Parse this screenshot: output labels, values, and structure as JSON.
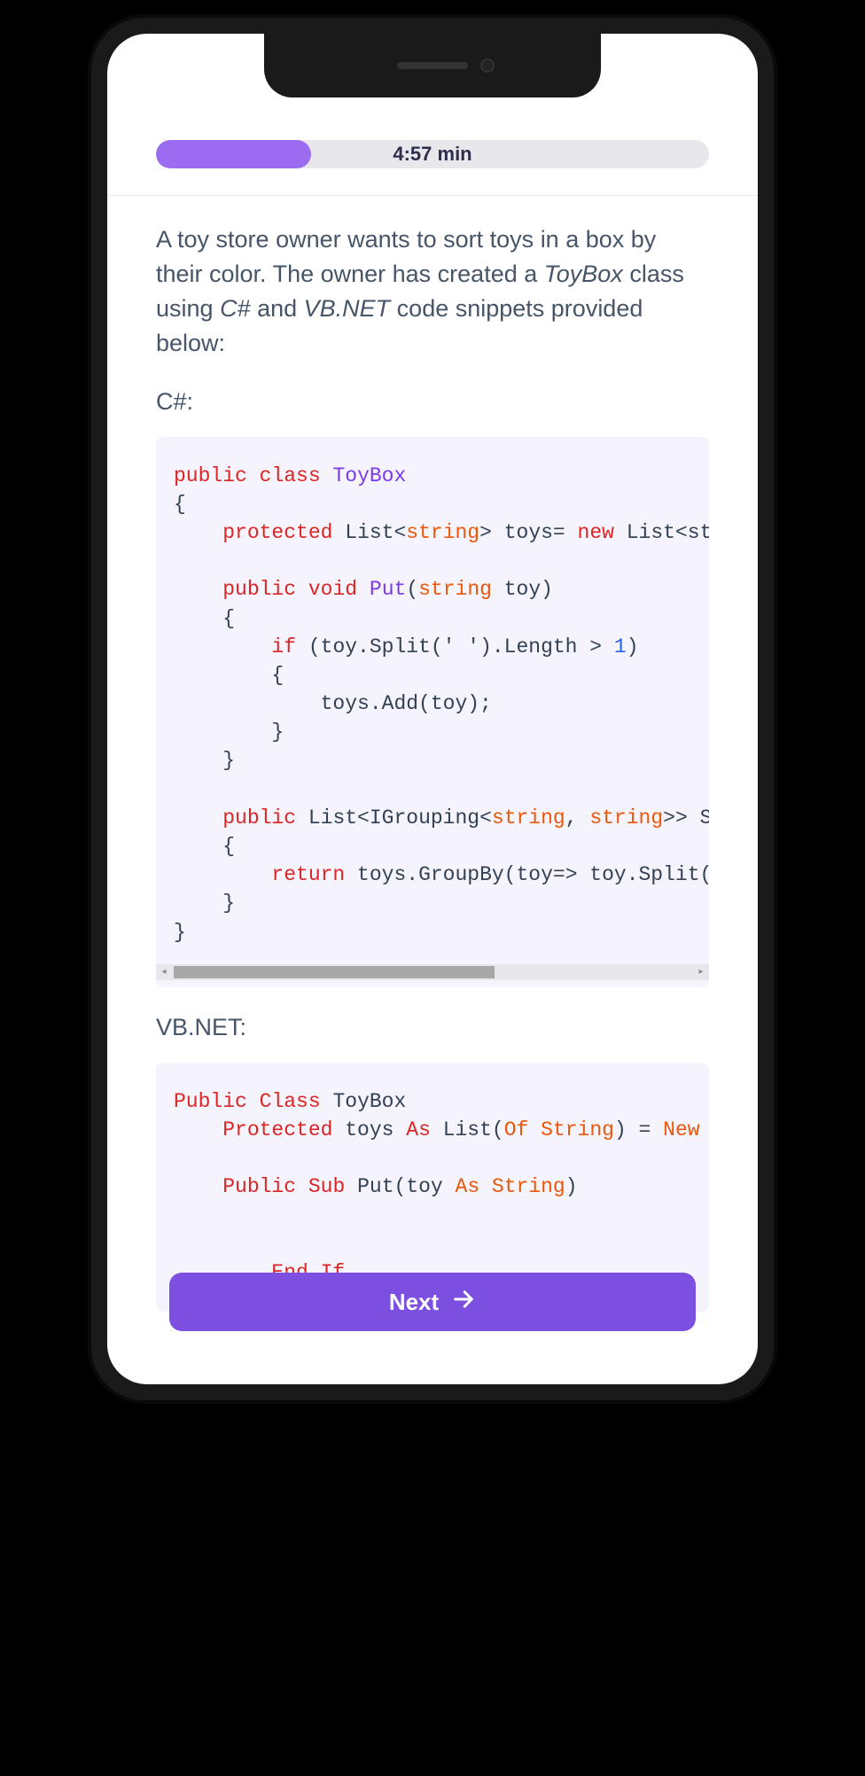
{
  "progress": {
    "time_text": "4:57 min",
    "fill_percent": 28
  },
  "question": {
    "intro_part1": "A toy store owner wants to sort toys in a box by their color. The owner has created a ",
    "em1": "ToyBox",
    "intro_part2": " class using ",
    "em2": "C#",
    "intro_part3": " and ",
    "em3": "VB.NET",
    "intro_part4": " code snippets provided below:"
  },
  "labels": {
    "csharp": "C#:",
    "vbnet": "VB.NET:"
  },
  "code": {
    "csharp": {
      "line1_kw1": "public",
      "line1_kw2": "class",
      "line1_name": "ToyBox",
      "line2": "{",
      "line3_kw": "protected",
      "line3_type": " List<",
      "line3_str": "string",
      "line3_rest": "> toys= ",
      "line3_new": "new",
      "line3_end": " List<st",
      "line5_kw1": "public",
      "line5_kw2": "void",
      "line5_func": "Put",
      "line5_paren": "(",
      "line5_str": "string",
      "line5_param": " toy)",
      "line6": "    {",
      "line7_kw": "if",
      "line7_rest": " (toy.Split(' ').Length > ",
      "line7_num": "1",
      "line7_end": ")",
      "line8": "        {",
      "line9": "            toys.Add(toy);",
      "line10": "        }",
      "line11": "    }",
      "line13_kw": "public",
      "line13_rest": " List<IGrouping<",
      "line13_str1": "string",
      "line13_comma": ", ",
      "line13_str2": "string",
      "line13_end": ">> S",
      "line14": "    {",
      "line15_kw": "return",
      "line15_rest": " toys.GroupBy(toy=> toy.Split(",
      "line16": "    }",
      "line17": "}"
    },
    "vbnet": {
      "line1_kw1": "Public",
      "line1_kw2": "Class",
      "line1_name": " ToyBox",
      "line2_kw": "Protected",
      "line2_mid": " toys ",
      "line2_as": "As",
      "line2_rest": " List(",
      "line2_of": "Of String",
      "line2_eq": ") = ",
      "line2_new": "New",
      "line4_kw1": "Public",
      "line4_kw2": "Sub",
      "line4_func": " Put(toy ",
      "line4_as": "As String",
      "line4_end": ")",
      "line6_kw": "End If"
    }
  },
  "button": {
    "label": "Next"
  }
}
